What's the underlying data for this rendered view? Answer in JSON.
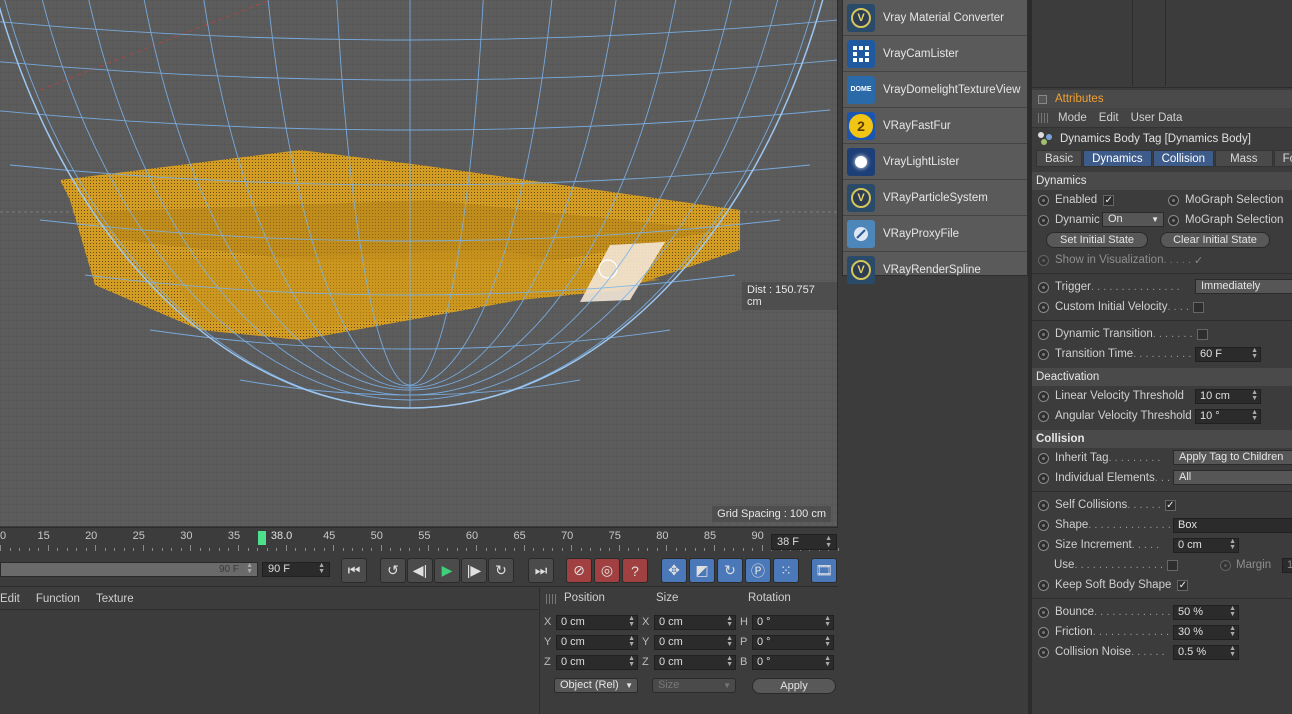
{
  "viewport": {
    "dist_label": "Dist : 150.757 cm",
    "grid_label": "Grid Spacing : 100 cm"
  },
  "plugins": [
    {
      "label": "Vray Material Converter",
      "icon": "vray-v-icon"
    },
    {
      "label": "VrayCamLister",
      "icon": "cam-lister-icon"
    },
    {
      "label": "VrayDomelightTextureView",
      "icon": "dome-icon",
      "badge": "DOME"
    },
    {
      "label": "VRayFastFur",
      "icon": "fast-fur-icon",
      "badge": "2"
    },
    {
      "label": "VrayLightLister",
      "icon": "light-lister-icon"
    },
    {
      "label": "VRayParticleSystem",
      "icon": "vray-v-icon"
    },
    {
      "label": "VRayProxyFile",
      "icon": "proxy-file-icon"
    },
    {
      "label": "VRayRenderSpline",
      "icon": "vray-v-icon"
    }
  ],
  "attributes": {
    "title": "Attributes",
    "menu": [
      "Mode",
      "Edit",
      "User Data"
    ],
    "object_name": "Dynamics Body Tag [Dynamics Body]",
    "tabs": [
      "Basic",
      "Dynamics",
      "Collision",
      "Mass",
      "For"
    ],
    "dynamics": {
      "heading": "Dynamics",
      "enabled_label": "Enabled",
      "mograph1": "MoGraph Selection",
      "dynamic_label": "Dynamic",
      "dynamic_value": "On",
      "mograph2": "MoGraph Selection",
      "set_initial": "Set Initial State",
      "clear_initial": "Clear Initial State",
      "show_vis": "Show in Visualization",
      "trigger_label": "Trigger",
      "trigger_value": "Immediately",
      "custom_vel": "Custom Initial Velocity",
      "dyn_transition": "Dynamic Transition",
      "transition_time": "Transition Time",
      "transition_time_value": "60 F"
    },
    "deactivation": {
      "heading": "Deactivation",
      "linear_label": "Linear Velocity Threshold",
      "linear_value": "10 cm",
      "angular_label": "Angular Velocity Threshold",
      "angular_value": "10 °"
    },
    "collision": {
      "heading": "Collision",
      "inherit_label": "Inherit Tag",
      "inherit_value": "Apply Tag to Children",
      "individual_label": "Individual Elements",
      "individual_value": "All",
      "self_col_label": "Self Collisions",
      "shape_label": "Shape",
      "shape_value": "Box",
      "size_inc_label": "Size Increment",
      "size_inc_value": "0 cm",
      "use_label": "Use",
      "margin_label": "Margin",
      "margin_value": "1",
      "keep_soft_label": "Keep Soft Body Shape",
      "bounce_label": "Bounce",
      "bounce_value": "50 %",
      "friction_label": "Friction",
      "friction_value": "30 %",
      "noise_label": "Collision Noise",
      "noise_value": "0.5 %"
    }
  },
  "timeline": {
    "ticks": [
      "0",
      "15",
      "20",
      "25",
      "30",
      "35",
      "38.0",
      "45",
      "50",
      "55",
      "60",
      "65",
      "70",
      "75",
      "80",
      "85",
      "90"
    ],
    "current_frame": "38 F",
    "range_end_bar": "90 F",
    "range_end": "90 F"
  },
  "material_menu": [
    "Edit",
    "Function",
    "Texture"
  ],
  "coordinates": {
    "headers": [
      "Position",
      "Size",
      "Rotation"
    ],
    "position": [
      {
        "axis": "X",
        "value": "0 cm"
      },
      {
        "axis": "Y",
        "value": "0 cm"
      },
      {
        "axis": "Z",
        "value": "0 cm"
      }
    ],
    "size": [
      {
        "axis": "X",
        "value": "0 cm"
      },
      {
        "axis": "Y",
        "value": "0 cm"
      },
      {
        "axis": "Z",
        "value": "0 cm"
      }
    ],
    "rotation": [
      {
        "axis": "H",
        "value": "0 °"
      },
      {
        "axis": "P",
        "value": "0 °"
      },
      {
        "axis": "B",
        "value": "0 °"
      }
    ],
    "mode_dropdown": "Object (Rel)",
    "size_dropdown": "Size",
    "apply_label": "Apply"
  },
  "colors": {
    "accent_attributes": "#f0a030",
    "tab_active": "#3e5c8a",
    "playhead": "#4ee08a",
    "wireframe": "#6aa8e8",
    "object": "#d9a020"
  }
}
